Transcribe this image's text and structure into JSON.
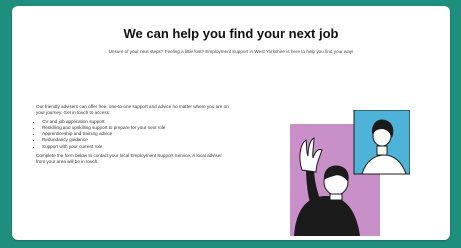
{
  "heading": "We can help you find your next job",
  "subheading": "Unsure of your next steps? Feeling a little lost? Employment Support in West Yorkshire is here to help you find your way!",
  "intro_line1": "Our friendly advisers can offer free, one-to-one support and advice no matter where you are on",
  "intro_line2": "your journey. Get in touch to access:",
  "services": [
    "CV and job application support",
    "Reskilling and upskilling support to prepare for your next role",
    "Apprenticeship and training advice",
    "Redundancy guidance",
    "Support with your current role"
  ],
  "outro_line1": "Complete the form below to contact your local Employment Support Service. A local adviser",
  "outro_line2": "from your area will be in touch.",
  "colors": {
    "page_background": "#1e8f7f",
    "card": "#ffffff",
    "pink_panel": "#c98fc9",
    "blue_panel": "#4fb3d9"
  }
}
